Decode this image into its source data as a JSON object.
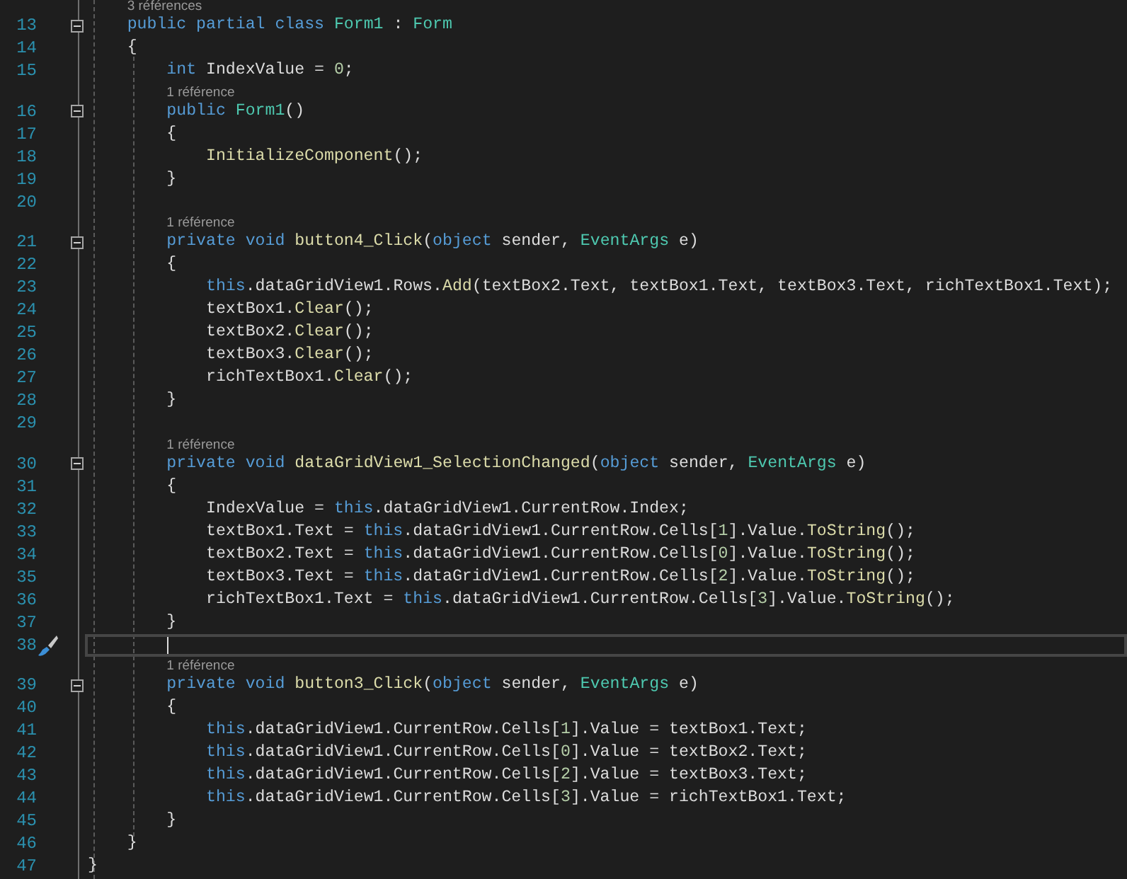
{
  "editor": {
    "lines": [
      {
        "number": "13",
        "lens": "3 références",
        "foldable": true,
        "current": false,
        "tokens": [
          {
            "kind": "keyword",
            "text": "    public"
          },
          {
            "kind": "keyword",
            "text": " partial"
          },
          {
            "kind": "keyword",
            "text": " class"
          },
          {
            "kind": "type",
            "text": " Form1"
          },
          {
            "kind": "plain",
            "text": " : "
          },
          {
            "kind": "type",
            "text": "Form"
          }
        ]
      },
      {
        "number": "14",
        "foldable": false,
        "current": false,
        "tokens": [
          {
            "kind": "plain",
            "text": "    {"
          }
        ]
      },
      {
        "number": "15",
        "foldable": false,
        "current": false,
        "tokens": [
          {
            "kind": "keyword",
            "text": "        int"
          },
          {
            "kind": "plain",
            "text": " IndexValue = "
          },
          {
            "kind": "number",
            "text": "0"
          },
          {
            "kind": "plain",
            "text": ";"
          }
        ]
      },
      {
        "number": "16",
        "lens": "1 référence",
        "foldable": true,
        "current": false,
        "tokens": [
          {
            "kind": "keyword",
            "text": "        public"
          },
          {
            "kind": "type",
            "text": " Form1"
          },
          {
            "kind": "plain",
            "text": "()"
          }
        ]
      },
      {
        "number": "17",
        "foldable": false,
        "current": false,
        "tokens": [
          {
            "kind": "plain",
            "text": "        {"
          }
        ]
      },
      {
        "number": "18",
        "foldable": false,
        "current": false,
        "tokens": [
          {
            "kind": "method",
            "text": "            InitializeComponent"
          },
          {
            "kind": "plain",
            "text": "();"
          }
        ]
      },
      {
        "number": "19",
        "foldable": false,
        "current": false,
        "tokens": [
          {
            "kind": "plain",
            "text": "        }"
          }
        ]
      },
      {
        "number": "20",
        "foldable": false,
        "current": false
      },
      {
        "number": "21",
        "lens": "1 référence",
        "foldable": true,
        "current": false,
        "tokens": [
          {
            "kind": "keyword",
            "text": "        private"
          },
          {
            "kind": "keyword",
            "text": " void"
          },
          {
            "kind": "method",
            "text": " button4_Click"
          },
          {
            "kind": "plain",
            "text": "("
          },
          {
            "kind": "keyword",
            "text": "object"
          },
          {
            "kind": "plain",
            "text": " sender, "
          },
          {
            "kind": "type",
            "text": "EventArgs"
          },
          {
            "kind": "plain",
            "text": " e)"
          }
        ]
      },
      {
        "number": "22",
        "foldable": false,
        "current": false,
        "tokens": [
          {
            "kind": "plain",
            "text": "        {"
          }
        ]
      },
      {
        "number": "23",
        "foldable": false,
        "current": false,
        "tokens": [
          {
            "kind": "keyword",
            "text": "            this"
          },
          {
            "kind": "plain",
            "text": ".dataGridView1.Rows."
          },
          {
            "kind": "method",
            "text": "Add"
          },
          {
            "kind": "plain",
            "text": "(textBox2.Text, textBox1.Text, textBox3.Text, richTextBox1.Text);"
          }
        ]
      },
      {
        "number": "24",
        "foldable": false,
        "current": false,
        "tokens": [
          {
            "kind": "plain",
            "text": "            textBox1."
          },
          {
            "kind": "method",
            "text": "Clear"
          },
          {
            "kind": "plain",
            "text": "();"
          }
        ]
      },
      {
        "number": "25",
        "foldable": false,
        "current": false,
        "tokens": [
          {
            "kind": "plain",
            "text": "            textBox2."
          },
          {
            "kind": "method",
            "text": "Clear"
          },
          {
            "kind": "plain",
            "text": "();"
          }
        ]
      },
      {
        "number": "26",
        "foldable": false,
        "current": false,
        "tokens": [
          {
            "kind": "plain",
            "text": "            textBox3."
          },
          {
            "kind": "method",
            "text": "Clear"
          },
          {
            "kind": "plain",
            "text": "();"
          }
        ]
      },
      {
        "number": "27",
        "foldable": false,
        "current": false,
        "tokens": [
          {
            "kind": "plain",
            "text": "            richTextBox1."
          },
          {
            "kind": "method",
            "text": "Clear"
          },
          {
            "kind": "plain",
            "text": "();"
          }
        ]
      },
      {
        "number": "28",
        "foldable": false,
        "current": false,
        "tokens": [
          {
            "kind": "plain",
            "text": "        }"
          }
        ]
      },
      {
        "number": "29",
        "foldable": false,
        "current": false
      },
      {
        "number": "30",
        "lens": "1 référence",
        "foldable": true,
        "current": false,
        "tokens": [
          {
            "kind": "keyword",
            "text": "        private"
          },
          {
            "kind": "keyword",
            "text": " void"
          },
          {
            "kind": "method",
            "text": " dataGridView1_SelectionChanged"
          },
          {
            "kind": "plain",
            "text": "("
          },
          {
            "kind": "keyword",
            "text": "object"
          },
          {
            "kind": "plain",
            "text": " sender, "
          },
          {
            "kind": "type",
            "text": "EventArgs"
          },
          {
            "kind": "plain",
            "text": " e)"
          }
        ]
      },
      {
        "number": "31",
        "foldable": false,
        "current": false,
        "tokens": [
          {
            "kind": "plain",
            "text": "        {"
          }
        ]
      },
      {
        "number": "32",
        "foldable": false,
        "current": false,
        "tokens": [
          {
            "kind": "plain",
            "text": "            IndexValue = "
          },
          {
            "kind": "keyword",
            "text": "this"
          },
          {
            "kind": "plain",
            "text": ".dataGridView1.CurrentRow.Index;"
          }
        ]
      },
      {
        "number": "33",
        "foldable": false,
        "current": false,
        "tokens": [
          {
            "kind": "plain",
            "text": "            textBox1.Text = "
          },
          {
            "kind": "keyword",
            "text": "this"
          },
          {
            "kind": "plain",
            "text": ".dataGridView1.CurrentRow.Cells["
          },
          {
            "kind": "number",
            "text": "1"
          },
          {
            "kind": "plain",
            "text": "].Value."
          },
          {
            "kind": "method",
            "text": "ToString"
          },
          {
            "kind": "plain",
            "text": "();"
          }
        ]
      },
      {
        "number": "34",
        "foldable": false,
        "current": false,
        "tokens": [
          {
            "kind": "plain",
            "text": "            textBox2.Text = "
          },
          {
            "kind": "keyword",
            "text": "this"
          },
          {
            "kind": "plain",
            "text": ".dataGridView1.CurrentRow.Cells["
          },
          {
            "kind": "number",
            "text": "0"
          },
          {
            "kind": "plain",
            "text": "].Value."
          },
          {
            "kind": "method",
            "text": "ToString"
          },
          {
            "kind": "plain",
            "text": "();"
          }
        ]
      },
      {
        "number": "35",
        "foldable": false,
        "current": false,
        "tokens": [
          {
            "kind": "plain",
            "text": "            textBox3.Text = "
          },
          {
            "kind": "keyword",
            "text": "this"
          },
          {
            "kind": "plain",
            "text": ".dataGridView1.CurrentRow.Cells["
          },
          {
            "kind": "number",
            "text": "2"
          },
          {
            "kind": "plain",
            "text": "].Value."
          },
          {
            "kind": "method",
            "text": "ToString"
          },
          {
            "kind": "plain",
            "text": "();"
          }
        ]
      },
      {
        "number": "36",
        "foldable": false,
        "current": false,
        "tokens": [
          {
            "kind": "plain",
            "text": "            richTextBox1.Text = "
          },
          {
            "kind": "keyword",
            "text": "this"
          },
          {
            "kind": "plain",
            "text": ".dataGridView1.CurrentRow.Cells["
          },
          {
            "kind": "number",
            "text": "3"
          },
          {
            "kind": "plain",
            "text": "].Value."
          },
          {
            "kind": "method",
            "text": "ToString"
          },
          {
            "kind": "plain",
            "text": "();"
          }
        ]
      },
      {
        "number": "37",
        "foldable": false,
        "current": false,
        "tokens": [
          {
            "kind": "plain",
            "text": "        }"
          }
        ]
      },
      {
        "number": "38",
        "foldable": false,
        "current": true
      },
      {
        "number": "39",
        "lens": "1 référence",
        "foldable": true,
        "current": false,
        "tokens": [
          {
            "kind": "keyword",
            "text": "        private"
          },
          {
            "kind": "keyword",
            "text": " void"
          },
          {
            "kind": "method",
            "text": " button3_Click"
          },
          {
            "kind": "plain",
            "text": "("
          },
          {
            "kind": "keyword",
            "text": "object"
          },
          {
            "kind": "plain",
            "text": " sender, "
          },
          {
            "kind": "type",
            "text": "EventArgs"
          },
          {
            "kind": "plain",
            "text": " e)"
          }
        ]
      },
      {
        "number": "40",
        "foldable": false,
        "current": false,
        "tokens": [
          {
            "kind": "plain",
            "text": "        {"
          }
        ]
      },
      {
        "number": "41",
        "foldable": false,
        "current": false,
        "tokens": [
          {
            "kind": "keyword",
            "text": "            this"
          },
          {
            "kind": "plain",
            "text": ".dataGridView1.CurrentRow.Cells["
          },
          {
            "kind": "number",
            "text": "1"
          },
          {
            "kind": "plain",
            "text": "].Value = textBox1.Text;"
          }
        ]
      },
      {
        "number": "42",
        "foldable": false,
        "current": false,
        "tokens": [
          {
            "kind": "keyword",
            "text": "            this"
          },
          {
            "kind": "plain",
            "text": ".dataGridView1.CurrentRow.Cells["
          },
          {
            "kind": "number",
            "text": "0"
          },
          {
            "kind": "plain",
            "text": "].Value = textBox2.Text;"
          }
        ]
      },
      {
        "number": "43",
        "foldable": false,
        "current": false,
        "tokens": [
          {
            "kind": "keyword",
            "text": "            this"
          },
          {
            "kind": "plain",
            "text": ".dataGridView1.CurrentRow.Cells["
          },
          {
            "kind": "number",
            "text": "2"
          },
          {
            "kind": "plain",
            "text": "].Value = textBox3.Text;"
          }
        ]
      },
      {
        "number": "44",
        "foldable": false,
        "current": false,
        "tokens": [
          {
            "kind": "keyword",
            "text": "            this"
          },
          {
            "kind": "plain",
            "text": ".dataGridView1.CurrentRow.Cells["
          },
          {
            "kind": "number",
            "text": "3"
          },
          {
            "kind": "plain",
            "text": "].Value = richTextBox1.Text;"
          }
        ]
      },
      {
        "number": "45",
        "foldable": false,
        "current": false,
        "tokens": [
          {
            "kind": "plain",
            "text": "        }"
          }
        ]
      },
      {
        "number": "46",
        "foldable": false,
        "current": false,
        "tokens": [
          {
            "kind": "plain",
            "text": "    }"
          }
        ]
      },
      {
        "number": "47",
        "foldable": false,
        "current": false,
        "tokens": [
          {
            "kind": "plain",
            "text": "}"
          }
        ]
      }
    ]
  }
}
